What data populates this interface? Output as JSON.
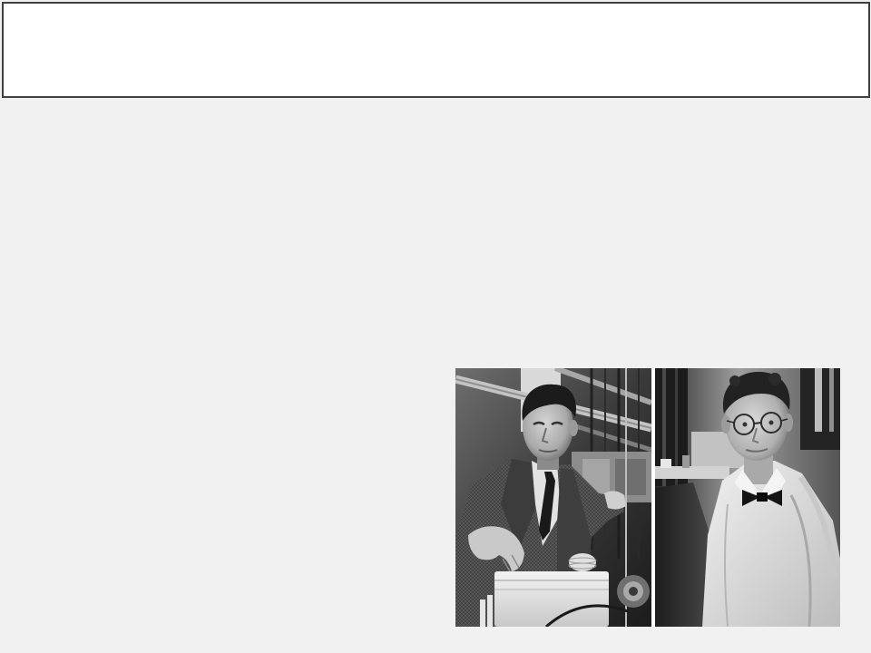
{
  "colors": {
    "page_background": "#f1f1f1",
    "header_background": "#ffffff",
    "header_border": "#404040"
  },
  "header": {
    "title": ""
  }
}
